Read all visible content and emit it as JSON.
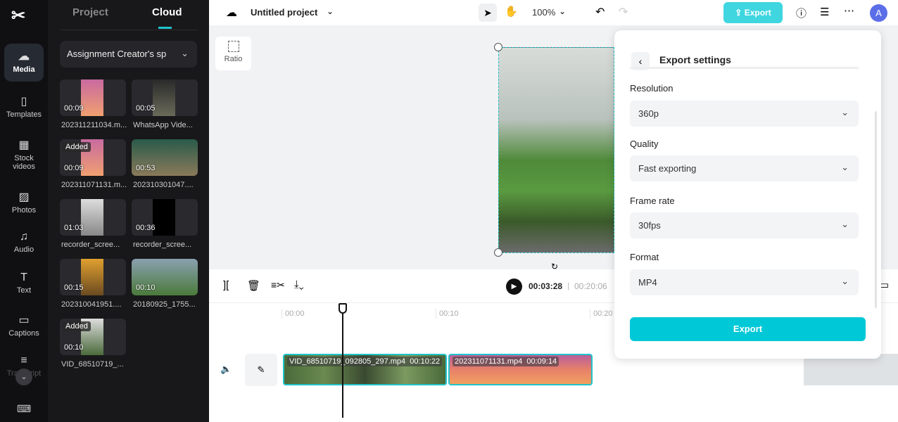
{
  "rail": {
    "items": [
      {
        "label": "Media",
        "icon": "cloud-upload-icon"
      },
      {
        "label": "Templates",
        "icon": "templates-icon"
      },
      {
        "label": "Stock videos",
        "icon": "film-icon"
      },
      {
        "label": "Photos",
        "icon": "image-icon"
      },
      {
        "label": "Audio",
        "icon": "music-icon"
      },
      {
        "label": "Text",
        "icon": "text-icon"
      },
      {
        "label": "Captions",
        "icon": "captions-icon"
      },
      {
        "label": "Transcript",
        "icon": "transcript-icon"
      }
    ]
  },
  "panel": {
    "tabs": [
      "Project",
      "Cloud"
    ],
    "active_tab": "Cloud",
    "folder": "Assignment Creator's sp",
    "media": [
      {
        "name": "202311211034.m...",
        "duration": "00:09",
        "added": ""
      },
      {
        "name": "WhatsApp Vide...",
        "duration": "00:05",
        "added": ""
      },
      {
        "name": "202311071131.m...",
        "duration": "00:09",
        "added": "Added"
      },
      {
        "name": "202310301047....",
        "duration": "00:53",
        "added": ""
      },
      {
        "name": "recorder_scree...",
        "duration": "01:03",
        "added": ""
      },
      {
        "name": "recorder_scree...",
        "duration": "00:36",
        "added": ""
      },
      {
        "name": "202310041951....",
        "duration": "00:15",
        "added": ""
      },
      {
        "name": "20180925_1755...",
        "duration": "00:10",
        "added": ""
      },
      {
        "name": "VID_68510719_...",
        "duration": "00:10",
        "added": "Added"
      }
    ]
  },
  "topbar": {
    "title": "Untitled project",
    "zoom": "100%",
    "export": "Export",
    "avatar": "A"
  },
  "canvas": {
    "ratio": "Ratio"
  },
  "player": {
    "current": "00:03:28",
    "total": "00:20:06"
  },
  "timeline": {
    "ticks": [
      "00:00",
      "00:10",
      "00:20"
    ],
    "clips": [
      {
        "name": "VID_68510719_092805_297.mp4",
        "duration": "00:10:22"
      },
      {
        "name": "202311071131.mp4",
        "duration": "00:09:14"
      }
    ]
  },
  "export_settings": {
    "title": "Export settings",
    "fields": [
      {
        "label": "Resolution",
        "value": "360p"
      },
      {
        "label": "Quality",
        "value": "Fast exporting"
      },
      {
        "label": "Frame rate",
        "value": "30fps"
      },
      {
        "label": "Format",
        "value": "MP4"
      }
    ],
    "button": "Export"
  },
  "colors": {
    "accent": "#00c8d7"
  }
}
